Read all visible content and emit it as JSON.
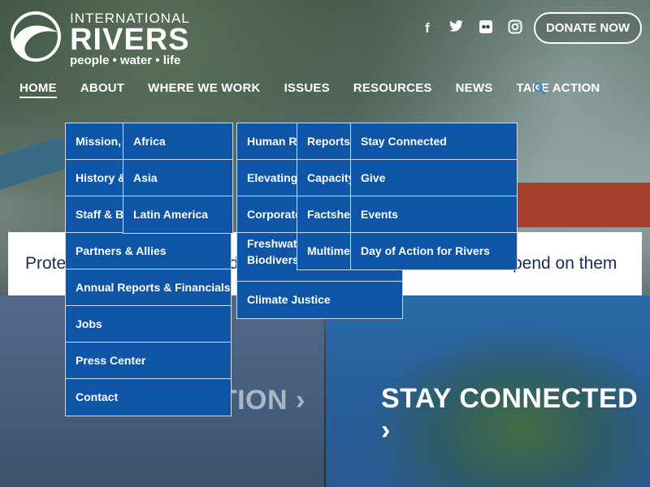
{
  "brand": {
    "top": "INTERNATIONAL",
    "main": "RIVERS",
    "sub": "people • water • life"
  },
  "socials": {
    "facebook": "f",
    "twitter": "t",
    "flickr": "●●",
    "instagram": "◎"
  },
  "donate_label": "DONATE NOW",
  "nav": {
    "items": [
      {
        "label": "HOME"
      },
      {
        "label": "ABOUT"
      },
      {
        "label": "WHERE WE WORK"
      },
      {
        "label": "ISSUES"
      },
      {
        "label": "RESOURCES"
      },
      {
        "label": "NEWS"
      },
      {
        "label": "TAKE ACTION"
      }
    ]
  },
  "tagline": "Protecting rivers and defending the rights of communities that depend on them",
  "panels": {
    "left_title": "TAKE ACTION ›",
    "right_title": "STAY CONNECTED ›"
  },
  "menus": {
    "about": [
      "Mission, Vision & Strategy",
      "History & Successes",
      "Staff & Board",
      "Partners & Allies",
      "Annual Reports & Financials",
      "Jobs",
      "Press Center",
      "Contact"
    ],
    "where_we_work": [
      "Africa",
      "Asia",
      "Latin America"
    ],
    "issues": [
      "Human Rights",
      "Elevating Women's Voices",
      "Corporate Accountability",
      "Freshwater Ecosystems & Biodiversity",
      "Climate Justice"
    ],
    "resources": [
      "Reports & Briefings",
      "Capacity Building Tools",
      "Factsheets",
      "Multimedia"
    ],
    "take_action": [
      "Stay Connected",
      "Give",
      "Events",
      "Day of Action for Rivers"
    ]
  },
  "colors": {
    "menu_bg": "#0e55a7",
    "brand_text": "#ffffff"
  },
  "icons": {
    "search": "search-icon"
  }
}
